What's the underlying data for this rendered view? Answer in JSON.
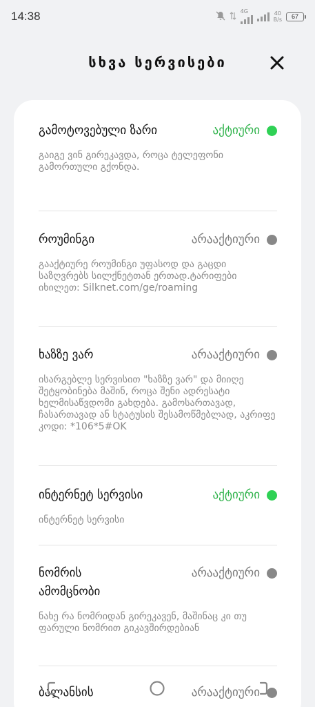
{
  "status_bar": {
    "time": "14:38",
    "network": "4G",
    "speed_value": "40",
    "speed_unit": "B/s",
    "battery": "67"
  },
  "header": {
    "title": "სხვა სერვისები",
    "close_icon": "close-icon"
  },
  "colors": {
    "active": "#2eb24a",
    "active_dot": "#2fd155",
    "inactive": "#7a7a7a"
  },
  "services": [
    {
      "name": "გამოტოვებული ზარი",
      "status": "აქტიური",
      "active": true,
      "description": "გაიგე ვინ გირეკავდა, როცა ტელეფონი გამორთული გქონდა."
    },
    {
      "name": "როუმინგი",
      "status": "არააქტიური",
      "active": false,
      "description": "გააქტიურე როუმინგი უფასოდ და გაცდი საზღვრებს სილქნეტთან ერთად.ტარიფები იხილეთ: Silknet.com/ge/roaming"
    },
    {
      "name": "ხაზზე ვარ",
      "status": "არააქტიური",
      "active": false,
      "description": "ისარგებლე სერვისით  \"ხაზზე ვარ\" და მიიღე შეტყობინება მაშინ, როცა შენი ადრესატი ხელმისაწვდომი გახდება. გამოსართავად, ჩასართავად ან სტატუსის შესამოწმებლად, აკრიფე კოდი: *106*5#OK"
    },
    {
      "name": "ინტერნეტ სერვისი",
      "status": "აქტიური",
      "active": true,
      "description": "ინტერნეტ სერვისი"
    },
    {
      "name": "ნომრის ამომცნობი",
      "status": "არააქტიური",
      "active": false,
      "description": "ნახე რა ნომრიდან გირეკავენ, მაშინაც კი თუ ფარული ნომრით გიკავშირდებიან"
    },
    {
      "name": "ბალანსის",
      "status": "არააქტიური",
      "active": false,
      "description": ""
    }
  ],
  "nav": {
    "back_icon": "back-icon",
    "home_icon": "home-icon",
    "recents_icon": "recents-icon"
  }
}
